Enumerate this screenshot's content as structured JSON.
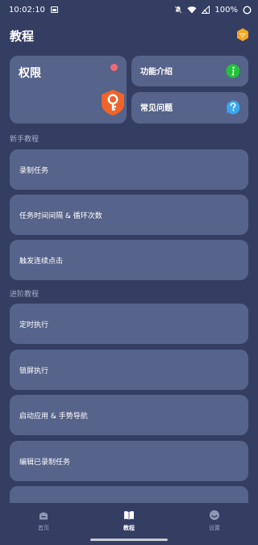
{
  "status_bar": {
    "time": "10:02:10",
    "battery": "100%"
  },
  "header": {
    "title": "教程"
  },
  "permission_card": {
    "title": "权限"
  },
  "intro_card": {
    "label": "功能介绍"
  },
  "faq_card": {
    "label": "常见问题"
  },
  "sections": {
    "beginner": "新手教程",
    "advanced": "进阶教程"
  },
  "beginner_items": [
    "录制任务",
    "任务时间间隔 & 循环次数",
    "触发连续点击"
  ],
  "advanced_items": [
    "定时执行",
    "锁屏执行",
    "启动应用 & 手势导航",
    "编辑已录制任务"
  ],
  "bottom_nav": [
    {
      "label": "首页",
      "icon": "home-icon",
      "active": false
    },
    {
      "label": "教程",
      "icon": "book-icon",
      "active": true
    },
    {
      "label": "设置",
      "icon": "settings-icon",
      "active": false
    }
  ],
  "colors": {
    "background": "#343e63",
    "card": "#56638a",
    "orange": "#f0642a",
    "green": "#22c437",
    "blue": "#3aa6f0",
    "badge": "#f5a623"
  }
}
